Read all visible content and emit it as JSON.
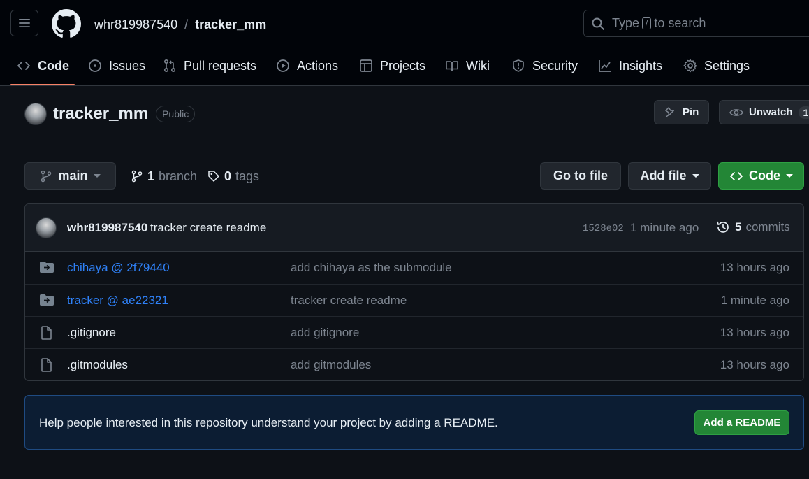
{
  "header": {
    "owner": "whr819987540",
    "separator": "/",
    "repo": "tracker_mm",
    "search": {
      "prefix": "Type",
      "key": "/",
      "suffix": "to search"
    }
  },
  "nav": {
    "tabs": [
      {
        "label": "Code",
        "icon": "code-icon",
        "selected": true
      },
      {
        "label": "Issues",
        "icon": "issue-icon"
      },
      {
        "label": "Pull requests",
        "icon": "pull-request-icon"
      },
      {
        "label": "Actions",
        "icon": "play-icon"
      },
      {
        "label": "Projects",
        "icon": "table-icon"
      },
      {
        "label": "Wiki",
        "icon": "book-icon"
      },
      {
        "label": "Security",
        "icon": "shield-icon"
      },
      {
        "label": "Insights",
        "icon": "graph-icon"
      },
      {
        "label": "Settings",
        "icon": "gear-icon"
      }
    ]
  },
  "repo": {
    "title": "tracker_mm",
    "visibility": "Public",
    "pin_label": "Pin",
    "unwatch_label": "Unwatch",
    "watch_count": "1"
  },
  "branch_bar": {
    "branch": "main",
    "branch_count": "1",
    "branch_word": "branch",
    "tag_count": "0",
    "tag_word": "tags",
    "go_to_file": "Go to file",
    "add_file": "Add file",
    "code": "Code"
  },
  "latest_commit": {
    "author": "whr819987540",
    "message": "tracker create readme",
    "sha": "1528e02",
    "time": "1 minute ago",
    "commit_count": "5",
    "commit_word": "commits"
  },
  "files": [
    {
      "name": "chihaya @ 2f79440",
      "type": "submodule",
      "message": "add chihaya as the submodule",
      "time": "13 hours ago"
    },
    {
      "name": "tracker @ ae22321",
      "type": "submodule",
      "message": "tracker create readme",
      "time": "1 minute ago"
    },
    {
      "name": ".gitignore",
      "type": "file",
      "message": "add gitignore",
      "time": "13 hours ago"
    },
    {
      "name": ".gitmodules",
      "type": "file",
      "message": "add gitmodules",
      "time": "13 hours ago"
    }
  ],
  "readme_banner": {
    "text": "Help people interested in this repository understand your project by adding a README.",
    "button": "Add a README"
  },
  "colors": {
    "background": "#0d1117",
    "header_bg": "#010409",
    "border": "#30363d",
    "link": "#2f81f7",
    "green_button": "#238636",
    "tab_underline": "#f78166",
    "muted_text": "#7d8590"
  }
}
